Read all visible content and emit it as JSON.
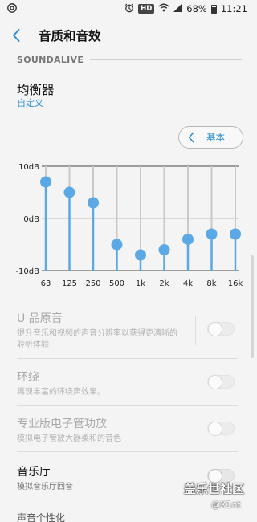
{
  "status_bar": {
    "hd": "HD",
    "battery": "68%",
    "time": "11:21",
    "icons": [
      "music-app-icon",
      "alarm-icon",
      "wifi-icon",
      "signal-icon",
      "battery-icon"
    ]
  },
  "header": {
    "title": "音质和音效",
    "back_icon": "chevron-left-icon"
  },
  "section": {
    "label": "SOUNDALIVE"
  },
  "equalizer": {
    "title": "均衡器",
    "preset": "自定义",
    "basic_button": "基本",
    "accent_color": "#5aa9e6",
    "chart_data": {
      "type": "line",
      "categories": [
        "63",
        "125",
        "250",
        "500",
        "1k",
        "2k",
        "4k",
        "8k",
        "16k"
      ],
      "values": [
        7,
        5,
        3,
        -5,
        -7,
        -6,
        -4,
        -3,
        -3
      ],
      "ylim": [
        -10,
        10
      ],
      "ytick_labels": [
        "10dB",
        "0dB",
        "-10dB"
      ]
    }
  },
  "settings": [
    {
      "id": "uhq",
      "title": "U 品原音",
      "desc": "提升音乐和视频的声音分辨率以获得更清晰的聆听体验",
      "enabled": false,
      "on": false
    },
    {
      "id": "surround",
      "title": "环绕",
      "desc": "再现丰富的环绕声效果。",
      "enabled": false,
      "on": false
    },
    {
      "id": "tube",
      "title": "专业版电子管功放",
      "desc": "模拟电子管放大器柔和的音色",
      "enabled": false,
      "on": false
    },
    {
      "id": "hall",
      "title": "音乐厅",
      "desc": "模拟音乐厅回音",
      "enabled": true,
      "on": false
    }
  ],
  "bottom_section": "声音个性化",
  "watermark": {
    "main": "盖乐世社区",
    "sub": "@X1nt"
  }
}
